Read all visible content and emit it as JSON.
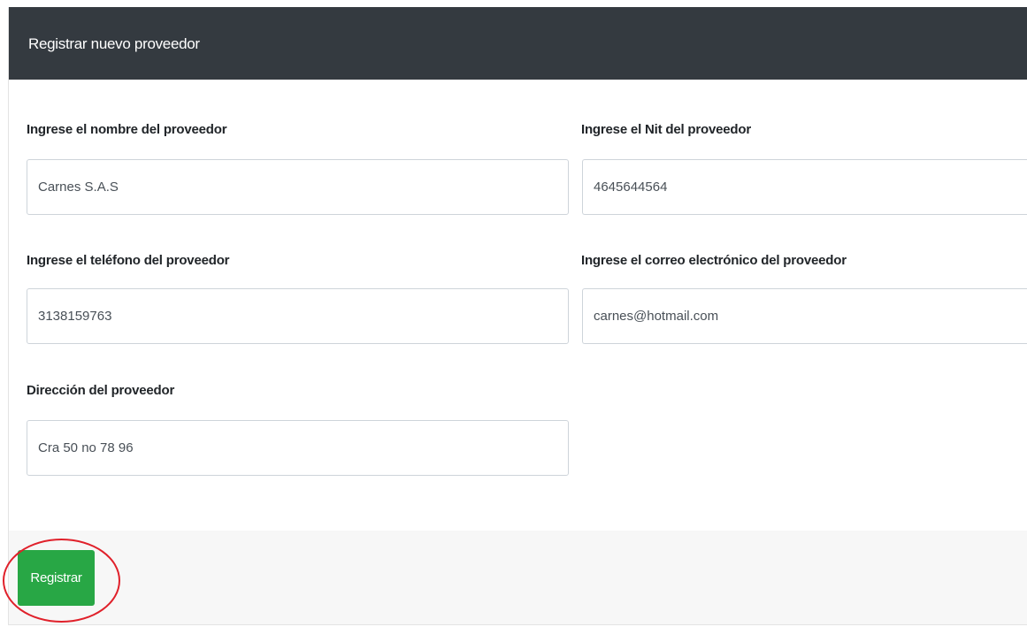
{
  "header": {
    "title": "Registrar nuevo proveedor"
  },
  "form": {
    "name": {
      "label": "Ingrese el nombre del proveedor",
      "value": "Carnes S.A.S"
    },
    "nit": {
      "label": "Ingrese el Nit del proveedor",
      "value": "4645644564"
    },
    "phone": {
      "label": "Ingrese el teléfono del proveedor",
      "value": "3138159763"
    },
    "email": {
      "label": "Ingrese el correo electrónico del proveedor",
      "value": "carnes@hotmail.com"
    },
    "address": {
      "label": "Dirección del proveedor",
      "value": "Cra 50 no 78 96"
    }
  },
  "footer": {
    "submit_label": "Registrar"
  },
  "annotation": {
    "highlight_color": "#e0202a"
  },
  "colors": {
    "header_bg": "#343a40",
    "button_bg": "#28a745",
    "footer_bg": "#f7f7f7"
  }
}
